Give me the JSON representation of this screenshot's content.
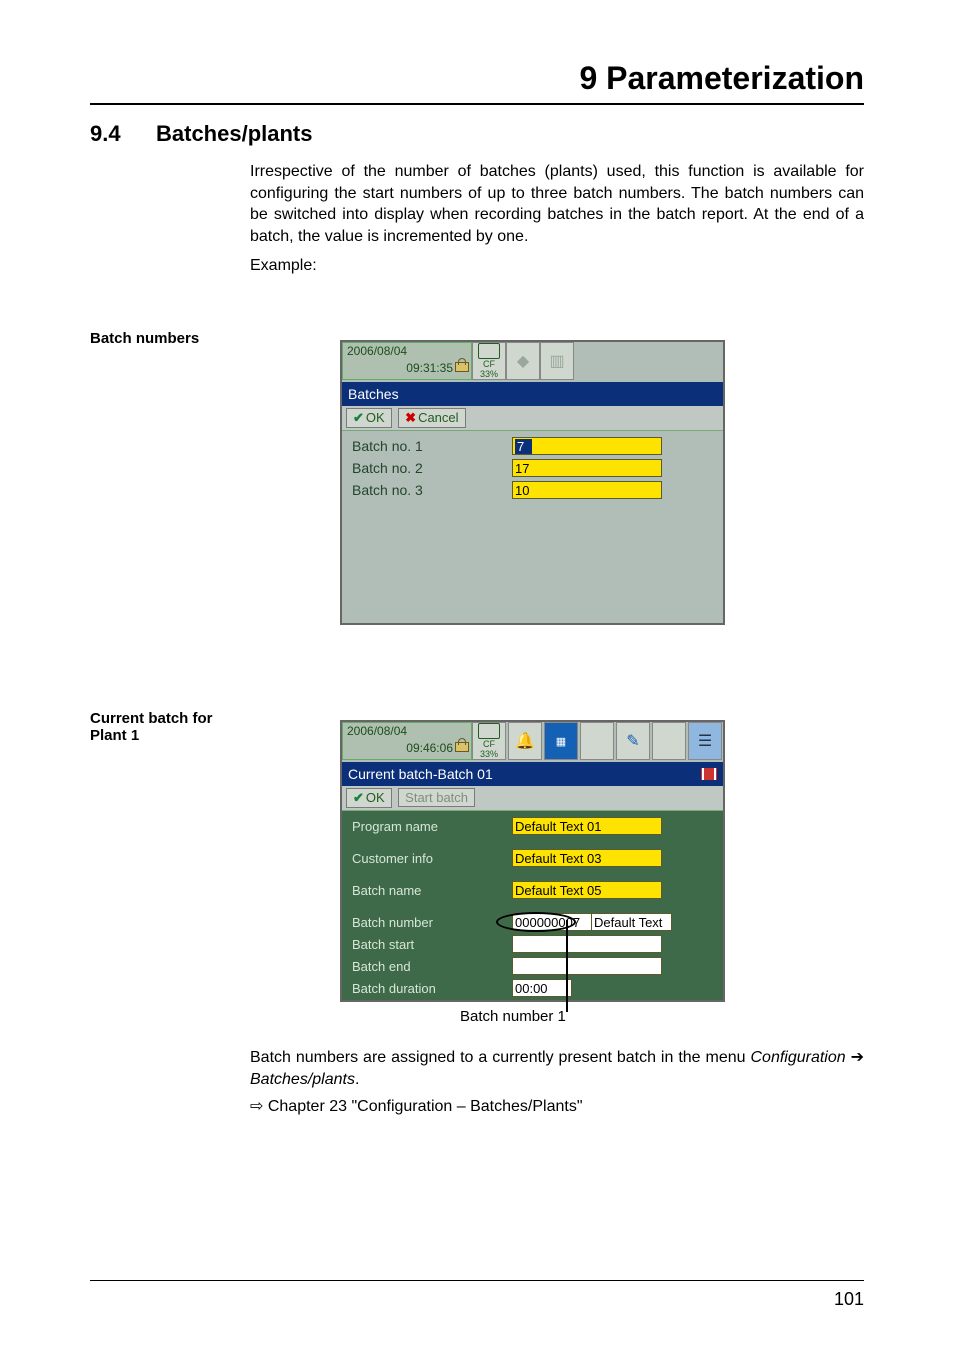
{
  "chapter_title": "9 Parameterization",
  "section": {
    "number": "9.4",
    "title": "Batches/plants"
  },
  "intro": "Irrespective of the number of batches (plants) used, this function is available for configuring the start numbers of up to three batch numbers. The batch numbers can be switched into display when recording batches in the batch report. At the end of a batch, the value is incremented by one.",
  "example_label": "Example:",
  "side_label_1": "Batch numbers",
  "side_label_2": "Current batch for Plant 1",
  "scr1": {
    "date": "2006/08/04",
    "time": "09:31:35",
    "chip_label": "CF",
    "chip_pct": "33%",
    "title": "Batches",
    "btn_ok": "OK",
    "btn_cancel": "Cancel",
    "rows": [
      {
        "label": "Batch no. 1",
        "value": "7",
        "selected": true
      },
      {
        "label": "Batch no. 2",
        "value": "17",
        "selected": false
      },
      {
        "label": "Batch no. 3",
        "value": "10",
        "selected": false
      }
    ]
  },
  "scr2": {
    "date": "2006/08/04",
    "time": "09:46:06",
    "chip_label": "CF",
    "chip_pct": "33%",
    "title": "Current batch-Batch 01",
    "btn_ok": "OK",
    "btn_start": "Start batch",
    "rows": [
      {
        "label": "Program name",
        "value": "Default Text 01"
      },
      {
        "label": "Customer info",
        "value": "Default Text 03"
      },
      {
        "label": "Batch name",
        "value": "Default Text 05"
      }
    ],
    "batch_number_label": "Batch number",
    "batch_number_value": "000000007",
    "batch_number_suffix": "Default Text",
    "batch_start_label": "Batch start",
    "batch_end_label": "Batch end",
    "batch_duration_label": "Batch duration",
    "batch_duration_value": "00:00"
  },
  "callout": "Batch number 1",
  "assign_text_1": "Batch numbers are assigned to a currently present batch in the menu ",
  "assign_text_italic_a": "Configuration",
  "assign_text_arrow": " ➔ ",
  "assign_text_italic_b": "Batches/plants",
  "assign_text_period": ".",
  "xref_prefix": "⇨",
  "xref_text": " Chapter 23 \"Configuration – Batches/Plants\"",
  "page_number": "101"
}
